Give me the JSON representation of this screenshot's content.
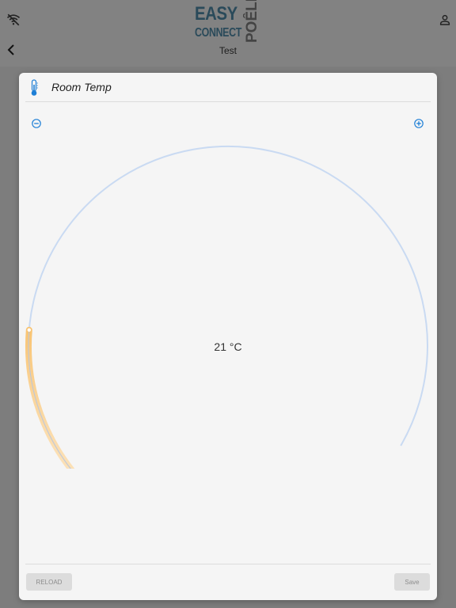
{
  "topbar": {
    "logo_line1": "EASY",
    "logo_line2": "CONNECT",
    "logo_side": "POÊLE",
    "nav_title": "Test",
    "icons": {
      "left": "wifi-off-icon",
      "right": "user-icon",
      "back": "chevron-left-icon"
    }
  },
  "dialog": {
    "title": "Room Temp",
    "title_icon": "thermometer-icon",
    "minus_icon": "minus-circle-icon",
    "plus_icon": "plus-circle-icon",
    "temperature": "21 °C",
    "gauge_level": 0.21,
    "reload_label": "RELOAD",
    "save_label": "Save"
  },
  "colors": {
    "accent": "#1e7fd6",
    "arc_track": "#c9daf2",
    "arc_fill_start": "#fdf0dc",
    "arc_fill_end": "#f8c06a"
  }
}
